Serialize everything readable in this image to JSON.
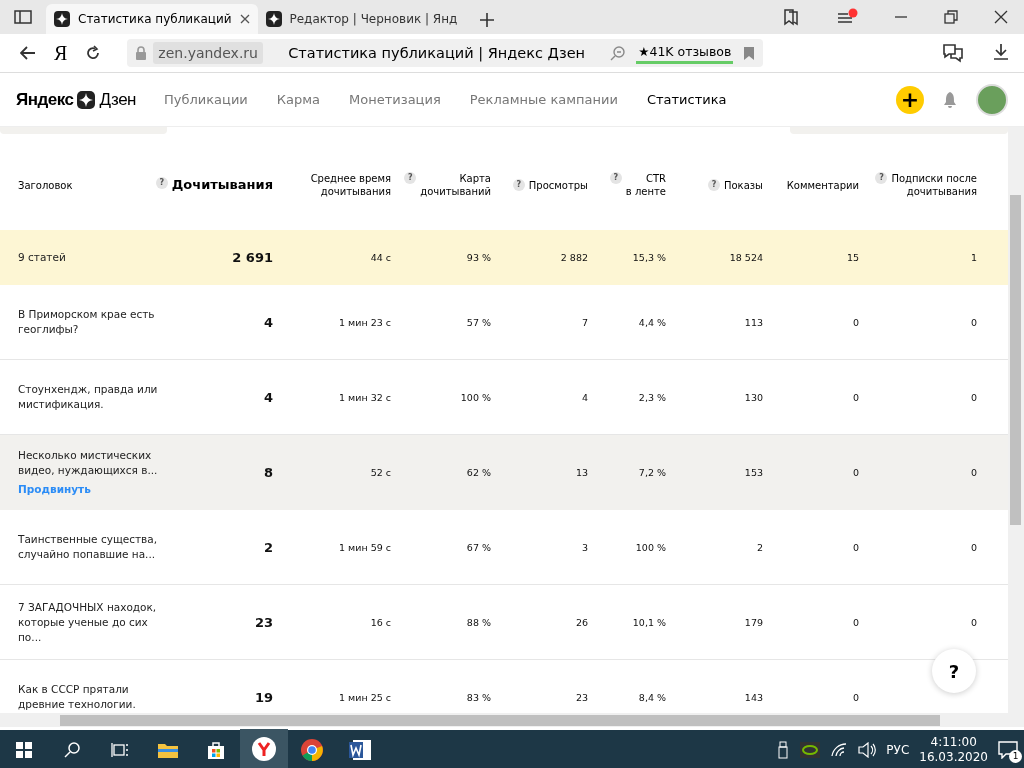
{
  "browser": {
    "tabs": [
      {
        "title": "Статистика публикаций",
        "selected": true
      },
      {
        "title": "Редактор | Черновик | Янд",
        "selected": false
      }
    ],
    "home": "Я",
    "domain": "zen.yandex.ru",
    "page_title": "Статистика публикаций | Яндекс Дзен",
    "reviews": "★41K отзывов"
  },
  "site": {
    "logo": [
      "Яндекс",
      "Дзен"
    ],
    "nav": [
      {
        "label": "Публикации",
        "selected": false
      },
      {
        "label": "Карма",
        "selected": false
      },
      {
        "label": "Монетизация",
        "selected": false
      },
      {
        "label": "Рекламные кампании",
        "selected": false
      },
      {
        "label": "Статистика",
        "selected": true
      }
    ],
    "add": "+"
  },
  "table": {
    "columns": [
      {
        "lines": [
          "Заголовок"
        ],
        "help": false,
        "main": false
      },
      {
        "lines": [
          "Дочитывания"
        ],
        "help": true,
        "main": true
      },
      {
        "lines": [
          "Среднее время",
          "дочитывания"
        ],
        "help": false,
        "main": false
      },
      {
        "lines": [
          "Карта",
          "дочитываний"
        ],
        "help": true,
        "main": false
      },
      {
        "lines": [
          "Просмотры"
        ],
        "help": true,
        "main": false
      },
      {
        "lines": [
          "CTR",
          "в ленте"
        ],
        "help": true,
        "main": false
      },
      {
        "lines": [
          "Показы"
        ],
        "help": true,
        "main": false
      },
      {
        "lines": [
          "Комментарии"
        ],
        "help": false,
        "main": false
      },
      {
        "lines": [
          "Подписки после",
          "дочитывания"
        ],
        "help": true,
        "main": false
      }
    ],
    "help_mark": "?",
    "summary": {
      "title": "9 статей",
      "values": [
        "2 691",
        "44 с",
        "93 %",
        "2 882",
        "15,3 %",
        "18 524",
        "15",
        "1"
      ]
    },
    "rows": [
      {
        "title": "В Приморском крае есть геоглифы?",
        "highlighted": false,
        "values": [
          "4",
          "1 мин 23 с",
          "57 %",
          "7",
          "4,4 %",
          "113",
          "0",
          "0"
        ]
      },
      {
        "title": "Стоунхендж, правда или мистификация.",
        "highlighted": false,
        "values": [
          "4",
          "1 мин 32 с",
          "100 %",
          "4",
          "2,3 %",
          "130",
          "0",
          "0"
        ]
      },
      {
        "title": "Несколько мистических видео, нуждающихся в...",
        "highlighted": true,
        "action": "Продвинуть",
        "values": [
          "8",
          "52 с",
          "62 %",
          "13",
          "7,2 %",
          "153",
          "0",
          "0"
        ]
      },
      {
        "title": "Таинственные существа, случайно попавшие на...",
        "highlighted": false,
        "values": [
          "2",
          "1 мин 59 с",
          "67 %",
          "3",
          "100 %",
          "2",
          "0",
          "0"
        ]
      },
      {
        "title": "7 ЗАГАДОЧНЫХ находок, которые ученые до сих по...",
        "highlighted": false,
        "values": [
          "23",
          "16 с",
          "88 %",
          "26",
          "10,1 %",
          "179",
          "0",
          "0"
        ]
      },
      {
        "title": "Как в СССР прятали древние технологии.",
        "highlighted": false,
        "values": [
          "19",
          "1 мин 25 с",
          "83 %",
          "23",
          "8,4 %",
          "143",
          "0"
        ]
      }
    ]
  },
  "help_button": "?",
  "taskbar": {
    "lang": "РУС",
    "time": "4:11:00",
    "date": "16.03.2020",
    "notifications": "1"
  }
}
